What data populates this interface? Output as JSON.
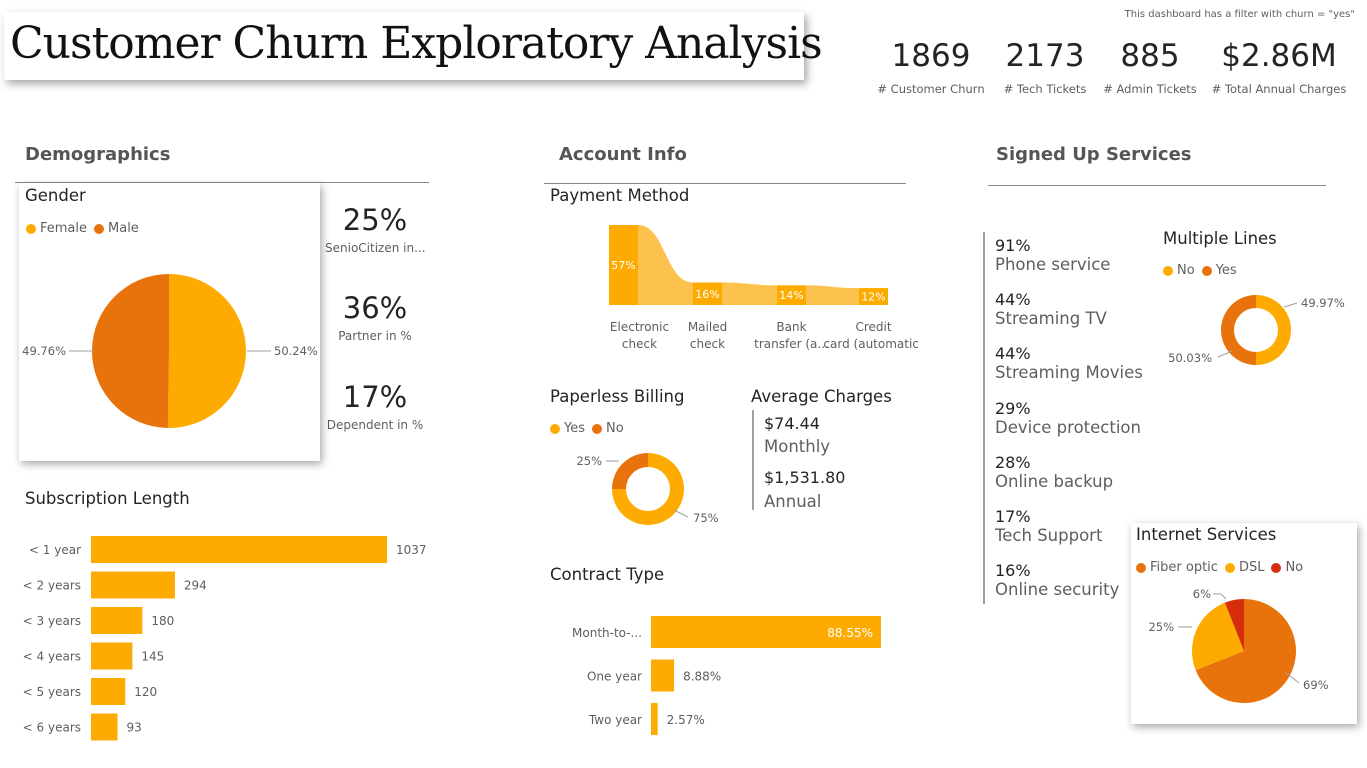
{
  "header": {
    "title": "Customer Churn Exploratory Analysis",
    "filter_note": "This dashboard has a filter with churn = \"yes\"",
    "kpis": [
      {
        "value": "1869",
        "label": "# Customer Churn"
      },
      {
        "value": "2173",
        "label": "# Tech Tickets"
      },
      {
        "value": "885",
        "label": "# Admin Tickets"
      },
      {
        "value": "$2.86M",
        "label": "# Total Annual Charges"
      }
    ]
  },
  "sections": {
    "demographics": "Demographics",
    "account": "Account Info",
    "services": "Signed Up Services"
  },
  "colors": {
    "yellow": "#FDAB00",
    "orange": "#E8720B",
    "red": "#D62D0A",
    "light": "#FDC24E"
  },
  "demographics": {
    "stats": [
      {
        "value": "25%",
        "label": "SenioCitizen in..."
      },
      {
        "value": "36%",
        "label": "Partner in %"
      },
      {
        "value": "17%",
        "label": "Dependent in %"
      }
    ]
  },
  "average_charges": {
    "title": "Average Charges",
    "monthly_value": "$74.44",
    "monthly_label": "Monthly",
    "annual_value": "$1,531.80",
    "annual_label": "Annual"
  },
  "services": [
    {
      "pct": "91%",
      "name": "Phone service"
    },
    {
      "pct": "44%",
      "name": "Streaming TV"
    },
    {
      "pct": "44%",
      "name": "Streaming Movies"
    },
    {
      "pct": "29%",
      "name": "Device protection"
    },
    {
      "pct": "28%",
      "name": "Online backup"
    },
    {
      "pct": "17%",
      "name": "Tech Support"
    },
    {
      "pct": "16%",
      "name": "Online security"
    }
  ],
  "chart_data": [
    {
      "id": "gender",
      "type": "pie",
      "title": "Gender",
      "categories": [
        "Female",
        "Male"
      ],
      "values": [
        50.24,
        49.76
      ],
      "value_labels": [
        "50.24%",
        "49.76%"
      ],
      "legend": "top-left"
    },
    {
      "id": "subscription",
      "type": "bar",
      "title": "Subscription Length",
      "categories": [
        "< 1 year",
        "< 2 years",
        "< 3 years",
        "< 4 years",
        "< 5 years",
        "< 6 years"
      ],
      "values": [
        1037,
        294,
        180,
        145,
        120,
        93
      ],
      "orientation": "horizontal",
      "xlim": [
        0,
        1037
      ]
    },
    {
      "id": "payment",
      "type": "bar",
      "title": "Payment Method",
      "categories": [
        "Electronic check",
        "Mailed check",
        "Bank transfer (a...",
        "Credit card (automatic)"
      ],
      "values": [
        57,
        16,
        14,
        12
      ],
      "value_labels": [
        "57%",
        "16%",
        "14%",
        "12%"
      ],
      "ylim": [
        0,
        57
      ]
    },
    {
      "id": "paperless",
      "type": "pie",
      "title": "Paperless Billing",
      "categories": [
        "Yes",
        "No"
      ],
      "values": [
        75,
        25
      ],
      "value_labels": [
        "75%",
        "25%"
      ],
      "legend": "top-left"
    },
    {
      "id": "contract",
      "type": "bar",
      "title": "Contract Type",
      "categories": [
        "Month-to-...",
        "One year",
        "Two year"
      ],
      "values": [
        88.55,
        8.88,
        2.57
      ],
      "value_labels": [
        "88.55%",
        "8.88%",
        "2.57%"
      ],
      "orientation": "horizontal",
      "xlim": [
        0,
        88.55
      ]
    },
    {
      "id": "multiple_lines",
      "type": "pie",
      "title": "Multiple Lines",
      "categories": [
        "No",
        "Yes"
      ],
      "values": [
        49.97,
        50.03
      ],
      "value_labels": [
        "49.97%",
        "50.03%"
      ],
      "legend": "top-left"
    },
    {
      "id": "internet",
      "type": "pie",
      "title": "Internet Services",
      "categories": [
        "Fiber optic",
        "DSL",
        "No"
      ],
      "values": [
        69,
        25,
        6
      ],
      "value_labels": [
        "69%",
        "25%",
        "6%"
      ],
      "legend": "top-left"
    }
  ]
}
